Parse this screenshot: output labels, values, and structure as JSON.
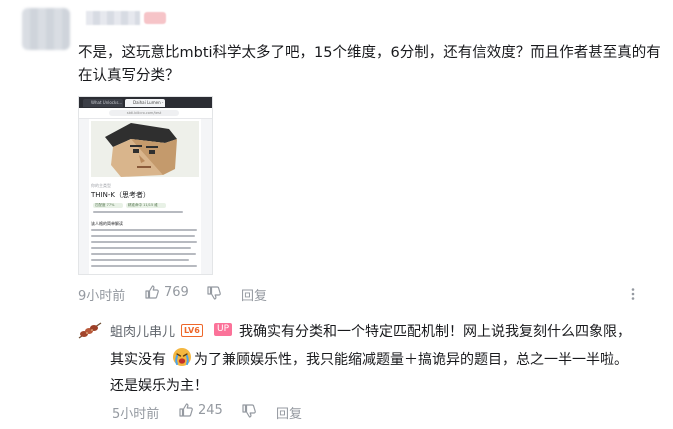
{
  "comment": {
    "text": "不是，这玩意比mbti科学太多了吧，15个维度，6分制，还有信效度？而且作者甚至真的有在认真写分类？",
    "time": "9小时前",
    "likes": "769",
    "reply_label": "回复"
  },
  "thumbnail": {
    "tab1": "What Unlocks...",
    "tab2": "Daihai Lumen -",
    "url": "sbti.bilicro.com/test",
    "kicker": "你的主类型",
    "title": "THIN-K（思考者）",
    "chips": [
      "匹配度 77%",
      "精准命中 11/15 维"
    ],
    "heading": "该人格的简单解读"
  },
  "reply": {
    "username": "蛆肉儿串儿",
    "level_badge": "LV6",
    "up_badge": "UP",
    "line1": "我确实有分类和一个特定匹配机制！网上说我复刻什么四象限，",
    "line2a": "其实没有",
    "line2b": "为了兼顾娱乐性，我只能缩减题量＋搞诡异的题目，总之一半一半啦。",
    "line3": "还是娱乐为主！",
    "time": "5小时前",
    "likes": "245",
    "reply_label": "回复"
  },
  "colors": {
    "text": "#18191c",
    "meta": "#9499a0",
    "up_pink": "#fb7299",
    "level_orange": "#ee672a"
  }
}
